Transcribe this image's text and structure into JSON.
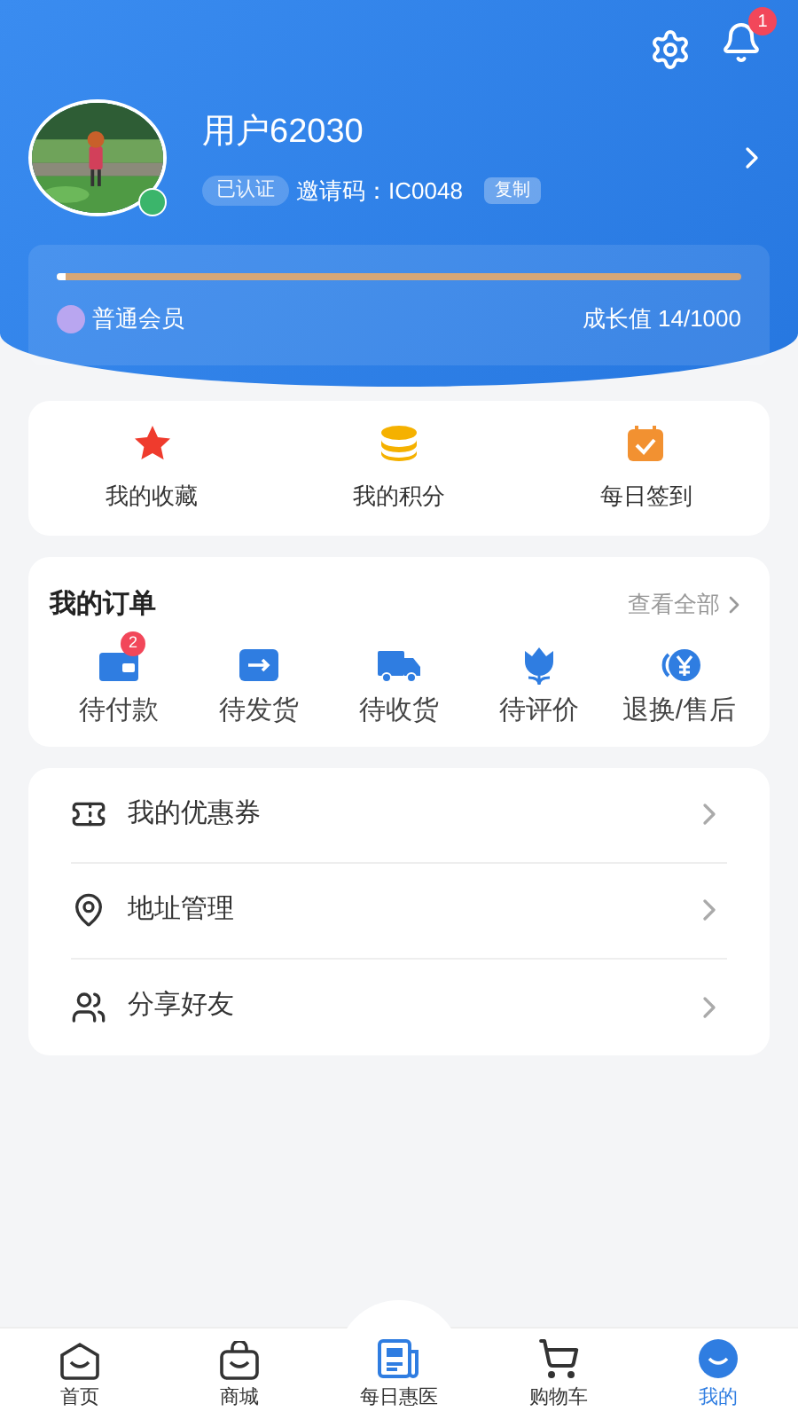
{
  "header": {
    "notification_count": "1",
    "user": {
      "name": "用户62030",
      "verified": "已认证",
      "invite": "邀请码：IC0048",
      "copy_button": "复制"
    },
    "membership": {
      "level_name": "普通会员",
      "growth": "成长值 14/1000",
      "level": 0.014
    }
  },
  "quick_links": [
    {
      "kind": "star",
      "label": "我的收藏"
    },
    {
      "kind": "coins",
      "label": "我的积分"
    },
    {
      "kind": "calendar",
      "label": "每日签到"
    }
  ],
  "orders": {
    "title": "我的订单",
    "view_all": "查看全部",
    "items": [
      {
        "kind": "wallet",
        "label": "待付款",
        "badge": "2"
      },
      {
        "kind": "box",
        "label": "待发货"
      },
      {
        "kind": "truck",
        "label": "待收货"
      },
      {
        "kind": "flower",
        "label": "待评价"
      },
      {
        "kind": "refund",
        "label": "退换/售后"
      }
    ]
  },
  "menu": [
    {
      "kind": "coupon",
      "label": "我的优惠券"
    },
    {
      "kind": "location",
      "label": "地址管理"
    },
    {
      "kind": "users",
      "label": "分享好友"
    }
  ],
  "tabbar": [
    {
      "kind": "home",
      "label": "首页",
      "selected": false
    },
    {
      "kind": "bag",
      "label": "商城",
      "selected": false
    },
    {
      "kind": "news",
      "label": "每日惠医",
      "selected": false
    },
    {
      "kind": "cart",
      "label": "购物车",
      "selected": false
    },
    {
      "kind": "me",
      "label": "我的",
      "selected": true
    }
  ]
}
